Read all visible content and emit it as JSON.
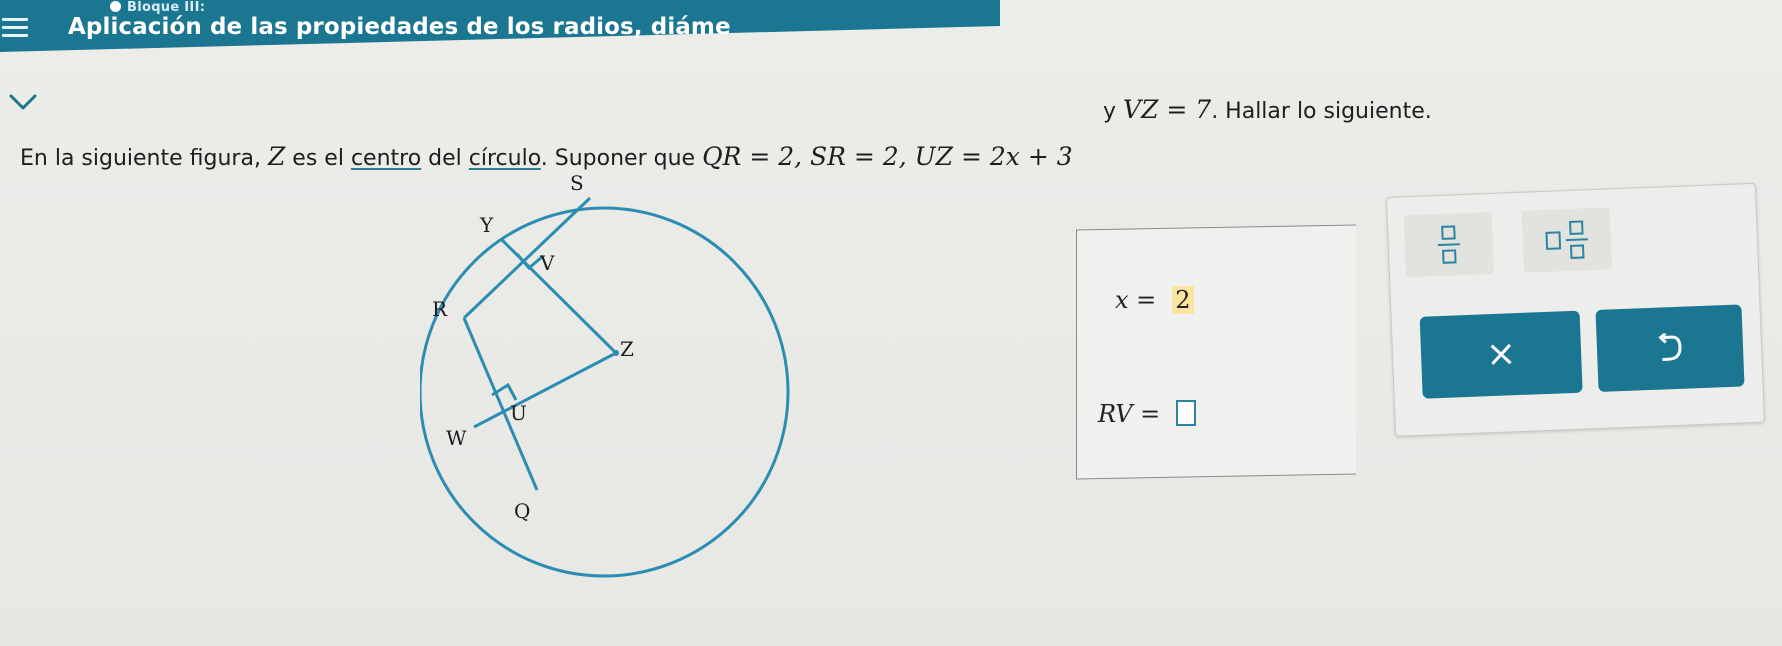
{
  "header": {
    "block_label": "Bloque III:",
    "title": "Aplicación de las propiedades de los radios, diáme"
  },
  "statement": {
    "intro": "En la siguiente figura, ",
    "center_var": "Z",
    "mid1": " es el ",
    "link_centro": "centro",
    "mid2": " del ",
    "link_circulo": "círculo",
    "mid3": ". Suponer que ",
    "given1": "QR = 2, SR = 2, UZ = 2x + 3",
    "y": " y ",
    "given2": "VZ = 7",
    "outro": ". Hallar lo siguiente."
  },
  "figure": {
    "labels": {
      "S": "S",
      "Y": "Y",
      "V": "V",
      "R": "R",
      "Z": "Z",
      "U": "U",
      "W": "W",
      "Q": "Q"
    },
    "stroke_color": "#2a8db1"
  },
  "answers": {
    "x_label": "x  =",
    "x_value": "2",
    "rv_label": "RV  ="
  },
  "palette": {
    "fraction_tool": "fraction-button",
    "mixed_tool": "mixed-number-button",
    "clear_label": "×",
    "undo_icon": "undo-icon"
  },
  "colors": {
    "accent": "#1a7691",
    "input_border": "#2c84a3",
    "highlight": "#fbe3a0"
  }
}
